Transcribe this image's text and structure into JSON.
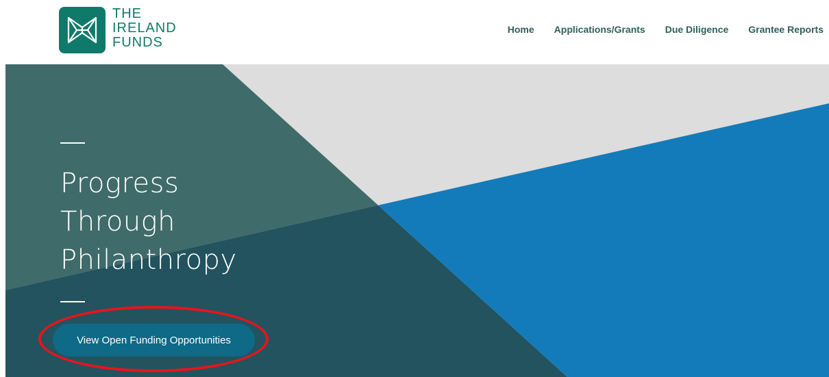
{
  "colors": {
    "brand": "#0f7a6a",
    "nav": "#2f5e5c",
    "hero_teal_light": "#3f6b6a",
    "hero_teal_dark": "#22535f",
    "hero_gray": "#dddddd",
    "hero_blue": "#137bba",
    "cta_bg": "#0e6a86",
    "highlight_ring": "#e8141c"
  },
  "logo": {
    "icon": "shamrock-emblem-icon",
    "lines": [
      "THE",
      "IRELAND",
      "FUNDS"
    ]
  },
  "nav": {
    "items": [
      {
        "label": "Home"
      },
      {
        "label": "Applications/Grants"
      },
      {
        "label": "Due Diligence"
      },
      {
        "label": "Grantee Reports"
      }
    ]
  },
  "hero": {
    "title_lines": [
      "Progress",
      "Through",
      "Philanthropy"
    ],
    "cta_label": "View Open Funding Opportunities"
  }
}
